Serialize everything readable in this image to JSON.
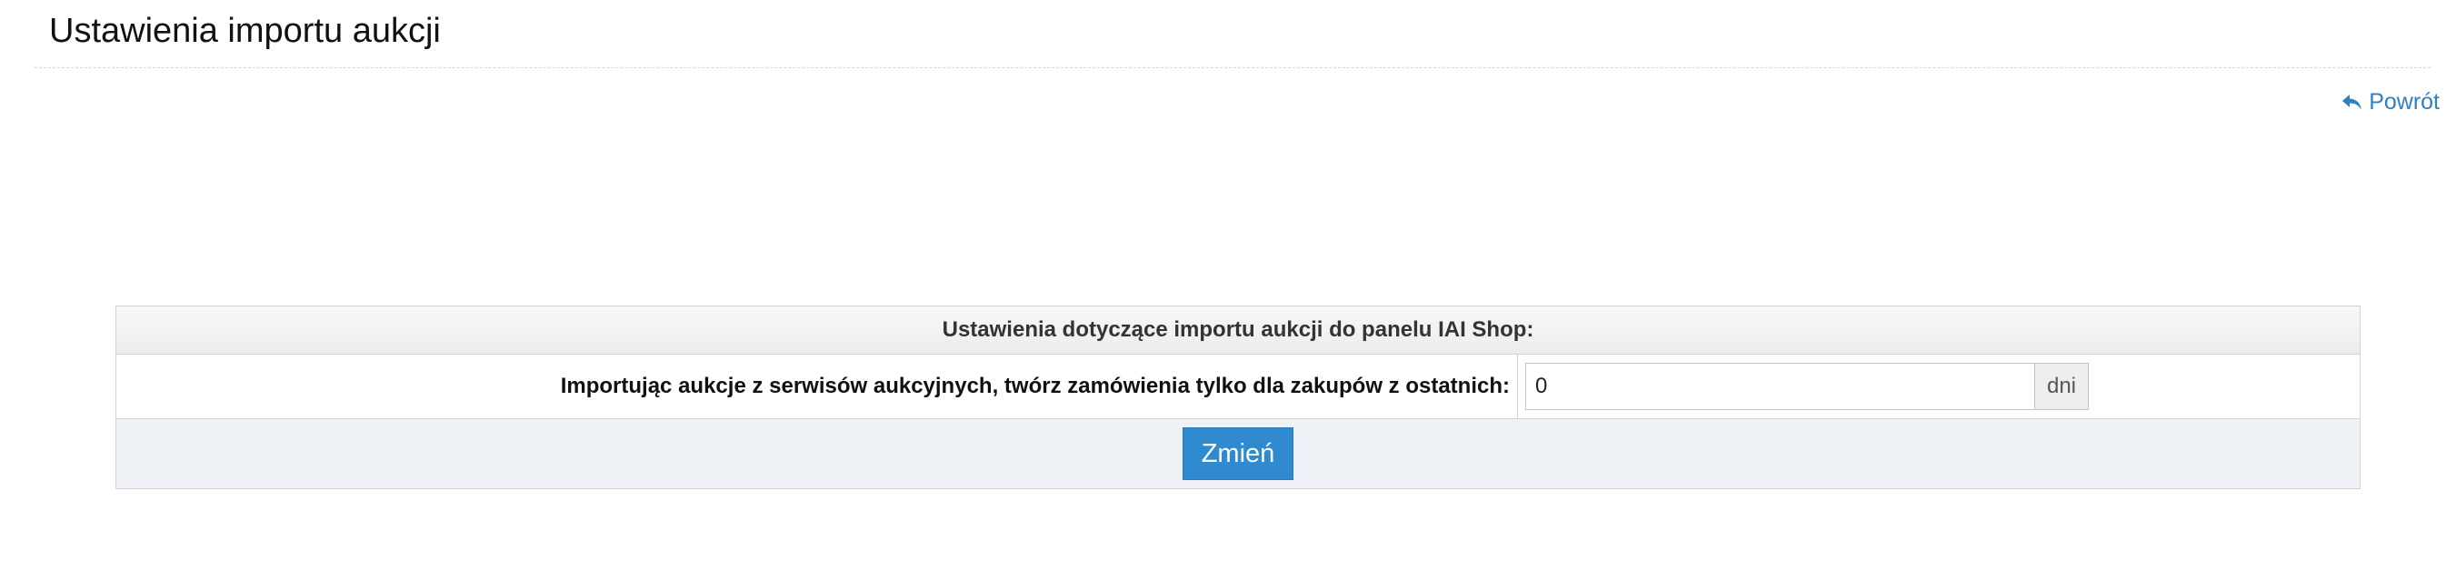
{
  "page": {
    "title": "Ustawienia importu aukcji",
    "back_label": "Powrót"
  },
  "settings": {
    "header": "Ustawienia dotyczące importu aukcji do panelu IAI Shop:",
    "row_label": "Importując aukcje z serwisów aukcyjnych, twórz zamówienia tylko dla zakupów z ostatnich:",
    "days_value": "0",
    "days_unit": "dni",
    "submit_label": "Zmień"
  },
  "colors": {
    "link": "#2f80c2",
    "button": "#2f8ad0",
    "footer_bg": "#eef2f7"
  },
  "icons": {
    "back": "reply-arrow-icon"
  }
}
